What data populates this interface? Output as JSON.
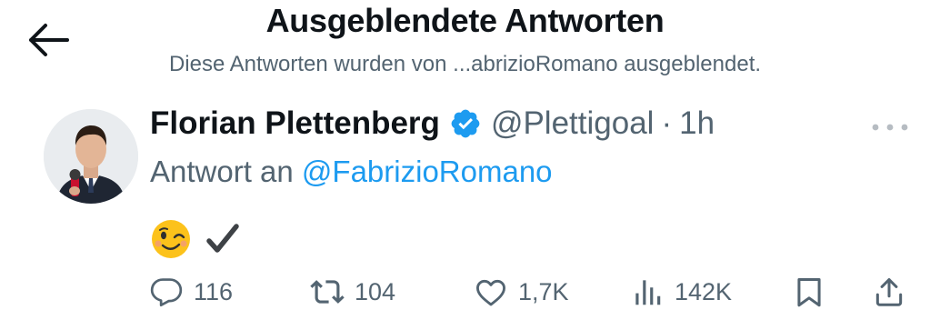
{
  "header": {
    "title": "Ausgeblendete Antworten",
    "subtitle": "Diese Antworten wurden von ...abrizioRomano ausgeblendet."
  },
  "tweet": {
    "author_name": "Florian Plettenberg",
    "handle": "@Plettigoal",
    "separator": "·",
    "time": "1h",
    "reply_prefix": "Antwort an",
    "reply_to": "@FabrizioRomano",
    "content_icons": [
      "winking-face-emoji",
      "heavy-check-mark"
    ]
  },
  "actions": {
    "replies": "116",
    "reposts": "104",
    "likes": "1,7K",
    "views": "142K"
  },
  "colors": {
    "text_primary": "#0f1419",
    "text_secondary": "#536471",
    "link": "#1d9bf0",
    "verified_badge": "#1d9bf0"
  }
}
